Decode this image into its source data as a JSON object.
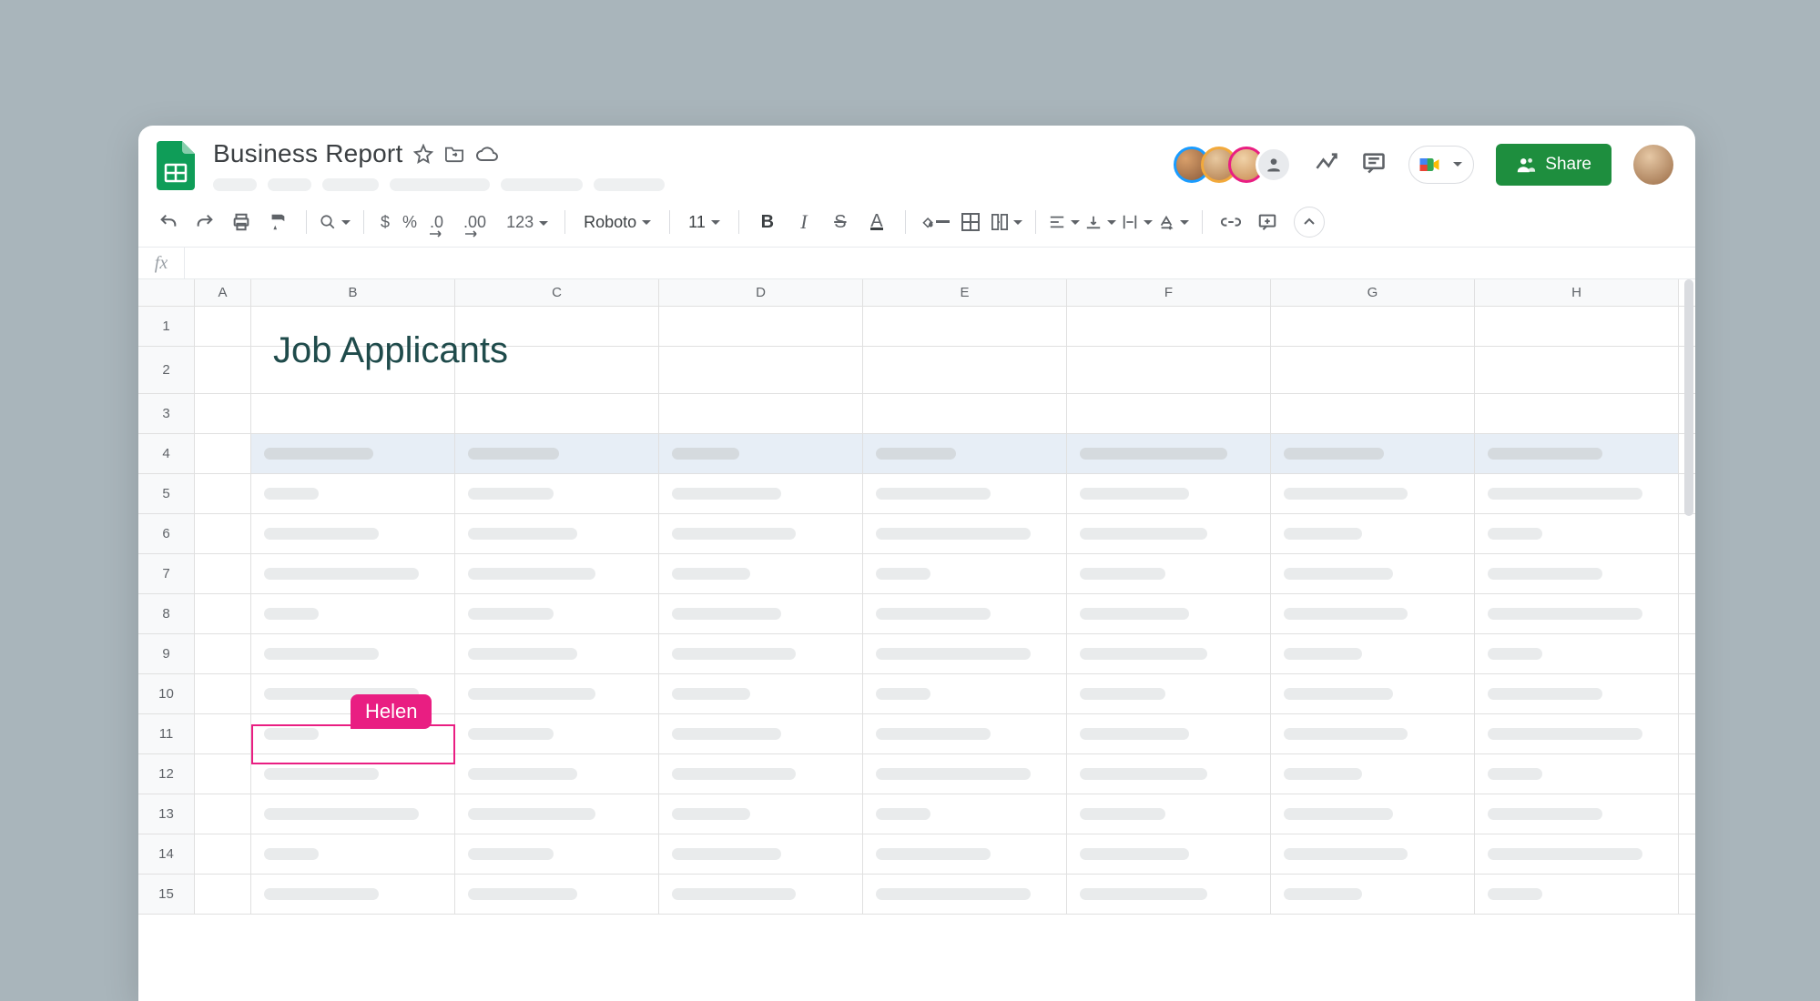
{
  "document": {
    "title": "Business Report"
  },
  "sheet": {
    "heading": "Job Applicants"
  },
  "toolbar": {
    "font": "Roboto",
    "fontSize": "11",
    "currency": "$",
    "percent": "%",
    "decDecrease": ".0",
    "decIncrease": ".00",
    "numFormat": "123"
  },
  "share": {
    "label": "Share"
  },
  "collaborator": {
    "name": "Helen",
    "color": "#e91e82"
  },
  "collaborators": {
    "rings": [
      "#1a9cff",
      "#f2a93b",
      "#e91e82"
    ]
  },
  "columns": [
    "A",
    "B",
    "C",
    "D",
    "E",
    "F",
    "G",
    "H"
  ],
  "rows": [
    "1",
    "2",
    "3",
    "4",
    "5",
    "6",
    "7",
    "8",
    "9",
    "10",
    "11",
    "12",
    "13",
    "14",
    "15"
  ],
  "placeholderWidths": {
    "header": [
      126,
      120,
      120,
      120,
      100,
      74,
      88,
      162,
      110
    ],
    "body": [
      126,
      120,
      136,
      170,
      140,
      86,
      60,
      94,
      120
    ]
  }
}
